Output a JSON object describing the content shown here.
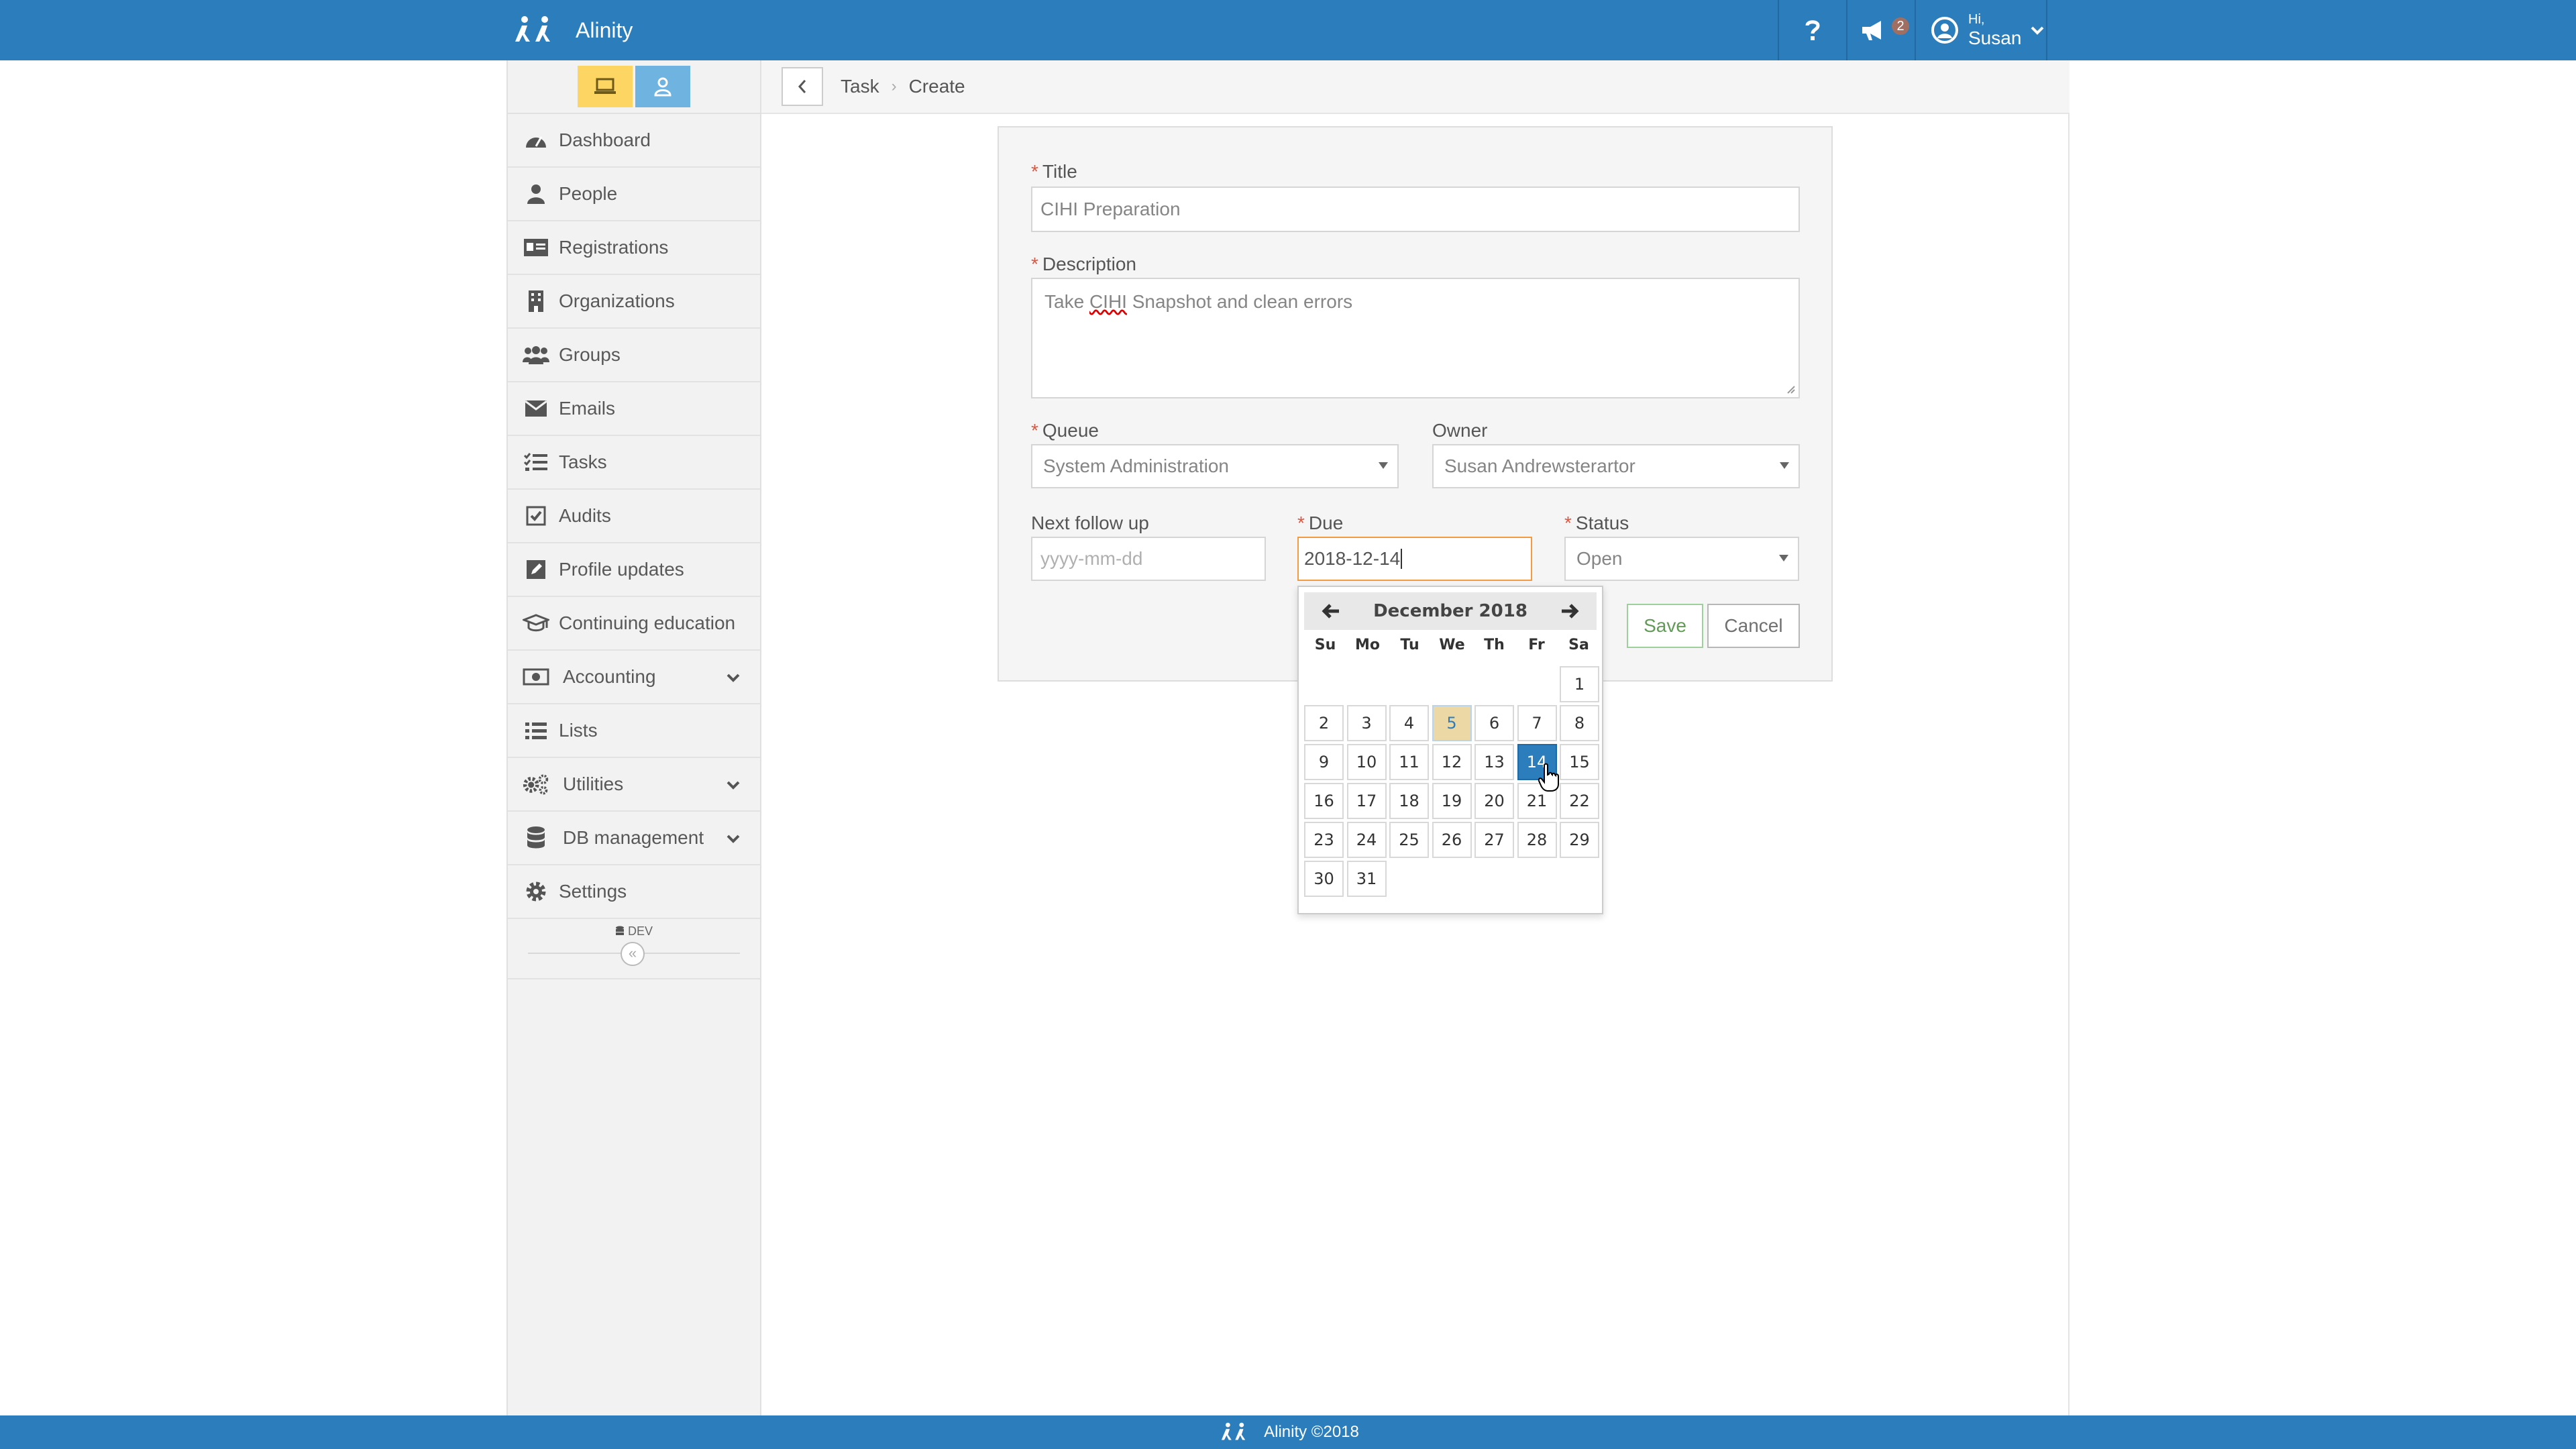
{
  "app": {
    "name": "Alinity"
  },
  "topbar": {
    "help_icon": "question-icon",
    "notifications": {
      "icon": "megaphone-icon",
      "count": "2"
    },
    "user": {
      "greeting": "Hi,",
      "name": "Susan",
      "icon": "user-circle-icon"
    }
  },
  "sidebar": {
    "shortcuts": [
      {
        "icon": "laptop-icon",
        "color": "#fdd562"
      },
      {
        "icon": "user-icon",
        "color": "#6fb3e0"
      }
    ],
    "items": [
      {
        "label": "Dashboard",
        "icon": "tachometer-icon"
      },
      {
        "label": "People",
        "icon": "person-icon"
      },
      {
        "label": "Registrations",
        "icon": "id-card-icon"
      },
      {
        "label": "Organizations",
        "icon": "building-icon"
      },
      {
        "label": "Groups",
        "icon": "users-icon"
      },
      {
        "label": "Emails",
        "icon": "envelope-icon"
      },
      {
        "label": "Tasks",
        "icon": "tasks-icon"
      },
      {
        "label": "Audits",
        "icon": "checkbox-icon"
      },
      {
        "label": "Profile updates",
        "icon": "edit-icon"
      },
      {
        "label": "Continuing education",
        "icon": "graduation-cap-icon"
      },
      {
        "label": "Accounting",
        "icon": "money-icon",
        "expandable": true
      },
      {
        "label": "Lists",
        "icon": "list-icon"
      },
      {
        "label": "Utilities",
        "icon": "cogs-icon",
        "expandable": true
      },
      {
        "label": "DB management",
        "icon": "database-icon",
        "expandable": true
      },
      {
        "label": "Settings",
        "icon": "gear-icon"
      }
    ],
    "env_label": "DEV",
    "collapse_glyph": "«"
  },
  "breadcrumb": {
    "items": [
      "Task",
      "Create"
    ]
  },
  "form": {
    "title": {
      "label": "Title",
      "value": "CIHI Preparation"
    },
    "description": {
      "label": "Description",
      "value_before": "Take ",
      "value_flagged": "CIHI",
      "value_after": " Snapshot and clean errors"
    },
    "queue": {
      "label": "Queue",
      "value": "System Administration"
    },
    "owner": {
      "label": "Owner",
      "value": "Susan Andrewsterartor"
    },
    "next_follow_up": {
      "label": "Next follow up",
      "placeholder": "yyyy-mm-dd"
    },
    "due": {
      "label": "Due",
      "value": "2018-12-14"
    },
    "status": {
      "label": "Status",
      "value": "Open"
    },
    "save_label": "Save",
    "cancel_label": "Cancel",
    "required_mark": "*"
  },
  "datepicker": {
    "title": "December 2018",
    "days_of_week": [
      "Su",
      "Mo",
      "Tu",
      "We",
      "Th",
      "Fr",
      "Sa"
    ],
    "first_weekday": 6,
    "days_in_month": 31,
    "today": 5,
    "selected": 14
  },
  "footer": {
    "text": "Alinity ©2018"
  },
  "colors": {
    "brand": "#2b7dbc",
    "focus": "#f59942",
    "required": "#d15b47",
    "save": "#629b58"
  }
}
